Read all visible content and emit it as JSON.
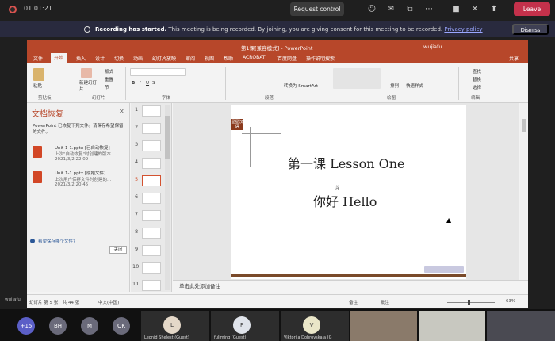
{
  "meeting": {
    "timer": "01:01:21",
    "request_control": "Request control",
    "leave": "Leave",
    "banner_bold": "Recording has started.",
    "banner_text": "This meeting is being recorded. By joining, you are giving consent for this meeting to be recorded.",
    "banner_link": "Privacy policy",
    "dismiss": "Dismiss",
    "shared_by": "wujiafu",
    "overflow_count": "+15",
    "participants": [
      {
        "initials": "BH",
        "color": "#6a6a7a"
      },
      {
        "initials": "M",
        "color": "#6a6a7a"
      },
      {
        "initials": "OK",
        "color": "#6a6a7a"
      }
    ],
    "tiles": [
      {
        "initials": "L",
        "name": "Leonid Shelest (Guest)",
        "color": "#e4d8c8"
      },
      {
        "initials": "F",
        "name": "fuliming (Guest)",
        "color": "#dfe3ea"
      },
      {
        "initials": "V",
        "name": "Viktoriia Dobrovskaia (G",
        "color": "#eae6c8"
      }
    ],
    "video_tiles": [
      {
        "name": "",
        "color": "#8a7a6a"
      },
      {
        "name": "",
        "color": "#c8c8c0"
      },
      {
        "name": "",
        "color": "#4a4a52"
      }
    ]
  },
  "ppt": {
    "window_title": "第1课[兼容模式] - PowerPoint",
    "user": "wujiafu",
    "tabs": [
      "文件",
      "开始",
      "插入",
      "设计",
      "切换",
      "动画",
      "幻灯片放映",
      "审阅",
      "视图",
      "帮助",
      "ACROBAT",
      "百度网盘"
    ],
    "active_tab": "开始",
    "tell_me": "操作说明搜索",
    "share": "共享",
    "ribbon": {
      "paste": "粘贴",
      "clipboard": "剪贴板",
      "new_slide": "新建幻灯片",
      "slides": "幻灯片",
      "layout": "版式",
      "reset": "重置",
      "section": "节",
      "font": "字体",
      "paragraph": "段落",
      "drawing": "绘图",
      "arrange": "排列",
      "quick_styles": "快速样式",
      "find": "查找",
      "replace": "替换",
      "select": "选择",
      "editing": "编辑",
      "smartart": "转换为 SmartArt"
    },
    "recovery": {
      "title": "文档恢复",
      "description": "PowerPoint 已恢复下列文件。请保存希望保留的文件。",
      "items": [
        {
          "name": "Unit 1-1.pptx  [已自动恢复]",
          "status": "上次\"自动恢复\"时创建的版本",
          "date": "2021/3/2 22:09"
        },
        {
          "name": "Unit 1-1.pptx  [原始文件]",
          "status": "上次用户保存文件时创建的...",
          "date": "2021/3/2 20:45"
        }
      ],
      "help": "希望保存哪个文件?",
      "close": "关闭"
    },
    "thumbnails": [
      "1",
      "2",
      "3",
      "4",
      "5",
      "6",
      "7",
      "8",
      "9",
      "10",
      "11"
    ],
    "selected_slide": "5",
    "slide": {
      "tag": "星星汉语",
      "line1": "第一课 Lesson One",
      "line2": "你好  Hello"
    },
    "notes_placeholder": "单击此处添加备注",
    "status": {
      "slide_count": "幻灯片 第 5 张，共 44 张",
      "language": "中文(中国)",
      "notes": "备注",
      "comments": "批注",
      "zoom": "63%"
    }
  }
}
